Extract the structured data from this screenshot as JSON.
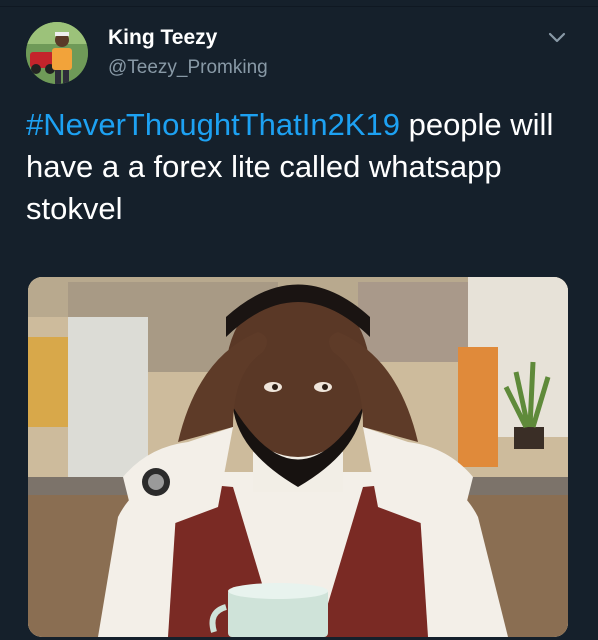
{
  "tweet": {
    "author_name": "King Teezy",
    "author_handle": "@Teezy_Promking",
    "hashtag": "#NeverThoughtThatIn2K19",
    "body": " people will have a a forex lite called whatsapp stokvel"
  },
  "icons": {
    "menu": "chevron-down-icon"
  },
  "colors": {
    "background": "#15202b",
    "link": "#1da1f2",
    "secondary_text": "#8899a6"
  }
}
